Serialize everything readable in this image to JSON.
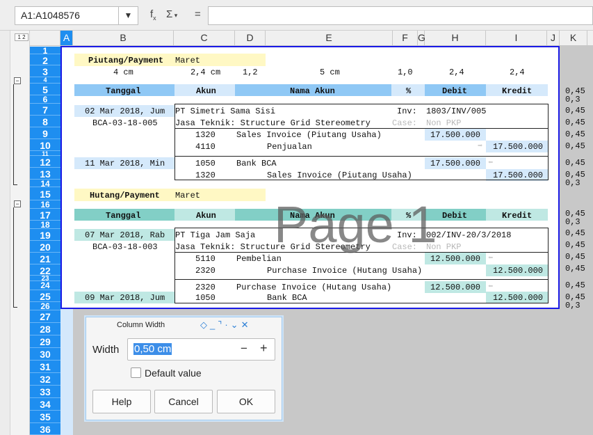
{
  "formula": {
    "name_box": "A1:A1048576",
    "fx": "fx",
    "sigma": "Σ",
    "equals": "="
  },
  "columns": [
    {
      "l": "A"
    },
    {
      "l": "B"
    },
    {
      "l": "C"
    },
    {
      "l": "D"
    },
    {
      "l": "E"
    },
    {
      "l": "F"
    },
    {
      "l": "G"
    },
    {
      "l": "H"
    },
    {
      "l": "I"
    },
    {
      "l": "J"
    },
    {
      "l": "K"
    }
  ],
  "rows": [
    "1",
    "2",
    "3",
    "4",
    "5",
    "6",
    "7",
    "8",
    "9",
    "10",
    "11",
    "12",
    "13",
    "14",
    "15",
    "16",
    "17",
    "18",
    "19",
    "20",
    "21",
    "22",
    "23",
    "24",
    "25",
    "26",
    "27",
    "28",
    "29",
    "30",
    "31",
    "32",
    "33",
    "34",
    "35",
    "36"
  ],
  "sheet": {
    "s1_title": "Piutang/Payment",
    "s1_month": "Maret",
    "widths": [
      "4 cm",
      "2,4 cm",
      "1,2",
      "5 cm",
      "1,0",
      "2,4",
      "2,4"
    ],
    "hdr": {
      "tanggal": "Tanggal",
      "akun": "Akun",
      "nama": "Nama Akun",
      "pct": "%",
      "debit": "Debit",
      "kredit": "Kredit"
    },
    "e1_date": "02 Mar 2018, Jum",
    "e1_ref": "BCA-03-18-005",
    "e1_party": "PT Simetri Sama Sisi",
    "inv_label": "Inv:",
    "e1_inv": "1803/INV/005",
    "e1_desc": "Jasa Teknik: Structure Grid Stereometry",
    "case_label": "Case:",
    "nonpkp": "Non PKP",
    "e1_a1": "1320",
    "e1_n1": "Sales Invoice (Piutang Usaha)",
    "e1_d1": "17.500.000",
    "e1_a2": "4110",
    "e1_n2": "Penjualan",
    "e1_k2": "17.500.000",
    "e2_date": "11 Mar 2018, Min",
    "e2_a1": "1050",
    "e2_n1": "Bank BCA",
    "e2_d1": "17.500.000",
    "e2_a2": "1320",
    "e2_n2": "Sales Invoice (Piutang Usaha)",
    "e2_k2": "17.500.000",
    "s2_title": "Hutang/Payment",
    "s2_month": "Maret",
    "e3_date": "07 Mar 2018, Rab",
    "e3_ref": "BCA-03-18-003",
    "e3_party": "PT Tiga Jam Saja",
    "e3_inv": "002/INV-20/3/2018",
    "e3_a1": "5110",
    "e3_n1": "Pembelian",
    "e3_d1": "12.500.000",
    "e3_a2": "2320",
    "e3_n2": "Purchase Invoice (Hutang Usaha)",
    "e3_k2": "12.500.000",
    "e4_a1": "2320",
    "e4_n1": "Purchase Invoice (Hutang Usaha)",
    "e4_d1": "12.500.000",
    "e4_date": "09 Mar 2018, Jum",
    "e4_a2": "1050",
    "e4_n2": "Bank BCA",
    "e4_k2": "12.500.000",
    "k045": "0,45",
    "k03": "0,3"
  },
  "watermark": "Page 1",
  "dialog": {
    "title": "Column Width",
    "width_label": "Width",
    "width_value": "0,50 cm",
    "minus": "−",
    "plus": "+",
    "default_label": "Default value",
    "help": "Help",
    "cancel": "Cancel",
    "ok": "OK"
  },
  "colors": {
    "blue_hdr": "#8fc8f5",
    "blue_light": "#d5e9fb",
    "yellow": "#fff8c4",
    "teal_hdr": "#82cfc6",
    "teal_light": "#bfe8e3",
    "row_hdr": "#1e8ef0"
  }
}
